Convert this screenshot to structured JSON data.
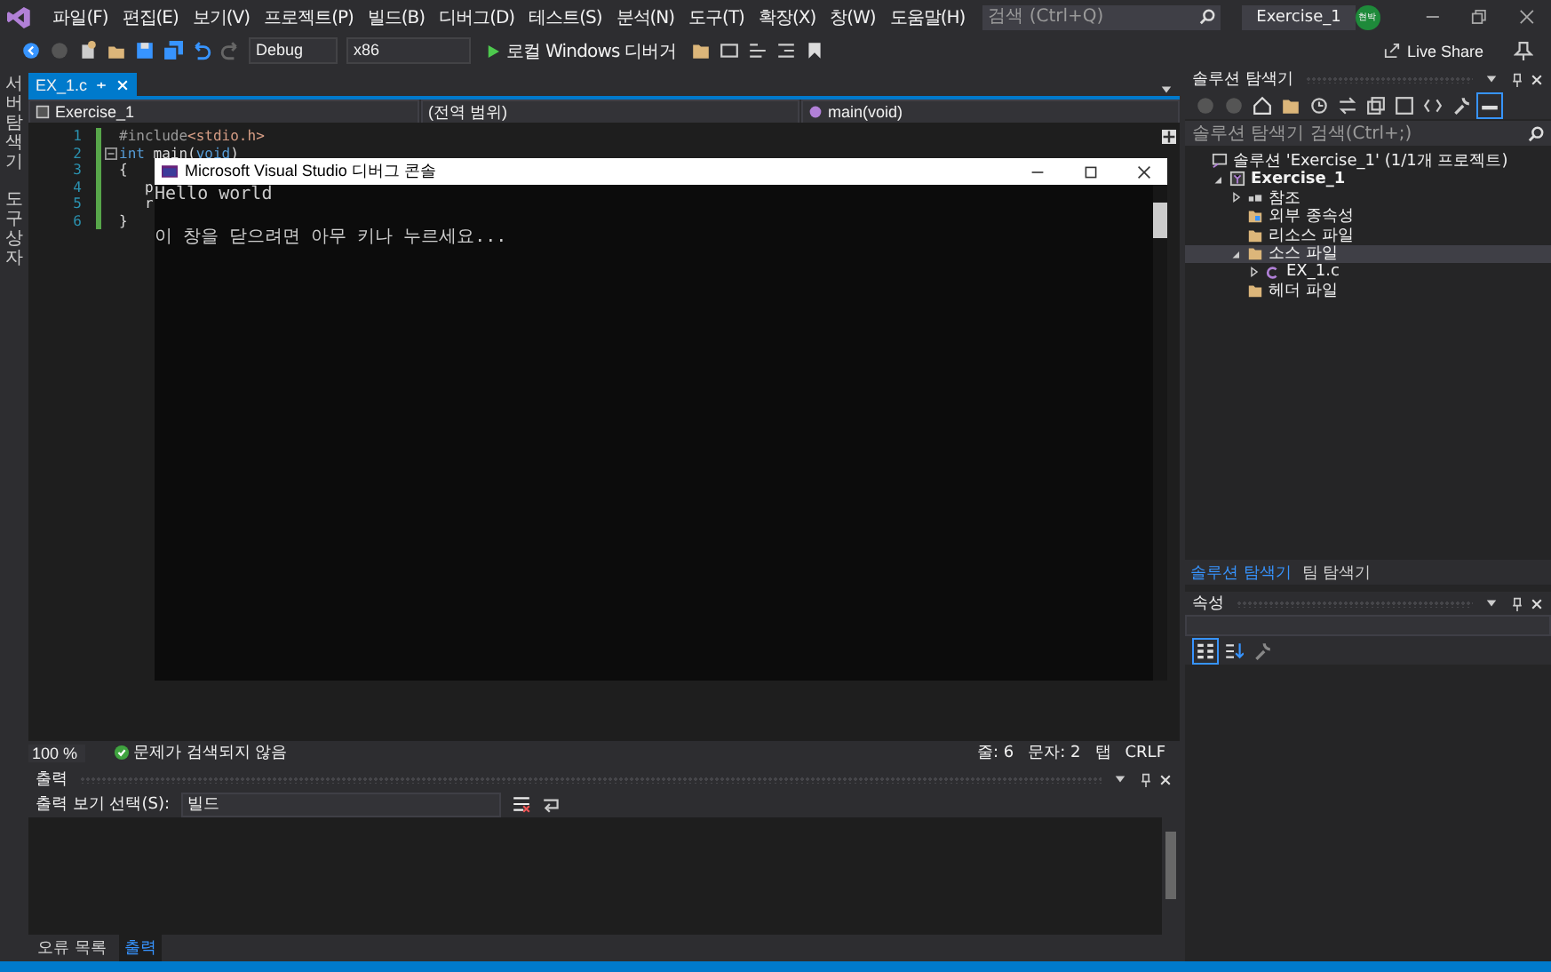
{
  "title_bar": {
    "menu": [
      "파일(F)",
      "편집(E)",
      "보기(V)",
      "프로젝트(P)",
      "빌드(B)",
      "디버그(D)",
      "테스트(S)",
      "분석(N)",
      "도구(T)",
      "확장(X)",
      "창(W)",
      "도움말(H)"
    ],
    "search": {
      "placeholder": "검색 (Ctrl+Q)"
    },
    "solution_name": "Exercise_1",
    "user_initials": "현박"
  },
  "toolbar": {
    "configuration": "Debug",
    "platform": "x86",
    "run_button": "로컬 Windows 디버거",
    "live_share": "Live Share"
  },
  "side_strip": [
    "서버 탐색기",
    "도구 상자"
  ],
  "editor": {
    "tabs": [
      {
        "label": "EX_1.c",
        "selected": true
      }
    ],
    "nav": {
      "project": "Exercise_1",
      "scope": "(전역 범위)",
      "member": "main(void)"
    },
    "lines": [
      {
        "number": "1",
        "segments": [
          {
            "kind": "directive",
            "text": "#include"
          },
          {
            "kind": "string",
            "text": "<stdio.h>"
          }
        ]
      },
      {
        "number": "2",
        "collapse": true,
        "segments": [
          {
            "kind": "keyword",
            "text": "int"
          },
          {
            "kind": "plain",
            "text": " main("
          },
          {
            "kind": "keyword",
            "text": "void"
          },
          {
            "kind": "plain",
            "text": ")"
          }
        ]
      },
      {
        "number": "3",
        "segments": [
          {
            "kind": "plain",
            "text": "{"
          }
        ]
      },
      {
        "number": "4",
        "segments": [
          {
            "kind": "plain",
            "text": "   p"
          }
        ]
      },
      {
        "number": "5",
        "segments": [
          {
            "kind": "plain",
            "text": "   r"
          }
        ]
      },
      {
        "number": "6",
        "segments": [
          {
            "kind": "plain",
            "text": "}"
          }
        ]
      }
    ],
    "zoom": "100 %",
    "issues": "문제가 검색되지 않음",
    "line_pos": "줄: 6",
    "col_pos": "문자: 2",
    "indent": "탭",
    "eol": "CRLF"
  },
  "console": {
    "title": "Microsoft Visual Studio 디버그 콘솔",
    "output": "Hello world",
    "prompt": "이 창을 닫으려면 아무 키나 누르세요..."
  },
  "output_panel": {
    "title": "출력",
    "source_label": "출력 보기 선택(S):",
    "source": "빌드"
  },
  "bottom_tabs": [
    {
      "label": "오류 목록",
      "selected": false
    },
    {
      "label": "출력",
      "selected": true
    }
  ],
  "solution_explorer": {
    "title": "솔루션 탐색기",
    "search": {
      "placeholder": "솔루션 탐색기 검색(Ctrl+;)"
    },
    "tree": [
      {
        "label": "솔루션 'Exercise_1' (1/1개 프로젝트)",
        "kind": "solution",
        "selected": false,
        "children": [
          {
            "label": "Exercise_1",
            "kind": "project",
            "expanded": true,
            "selected": false,
            "children": [
              {
                "label": "참조",
                "kind": "references",
                "expanded": false,
                "selected": false
              },
              {
                "label": "외부 종속성",
                "kind": "external",
                "selected": false
              },
              {
                "label": "리소스 파일",
                "kind": "folder",
                "selected": false
              },
              {
                "label": "소스 파일",
                "kind": "folder",
                "expanded": true,
                "selected": true,
                "children": [
                  {
                    "label": "EX_1.c",
                    "kind": "c_file",
                    "expanded": false,
                    "selected": false
                  }
                ]
              },
              {
                "label": "헤더 파일",
                "kind": "folder",
                "selected": false
              }
            ]
          }
        ]
      }
    ]
  },
  "panel_tabs": [
    {
      "label": "솔루션 탐색기",
      "selected": true
    },
    {
      "label": "팀 탐색기",
      "selected": false
    }
  ],
  "properties": {
    "title": "속성"
  }
}
